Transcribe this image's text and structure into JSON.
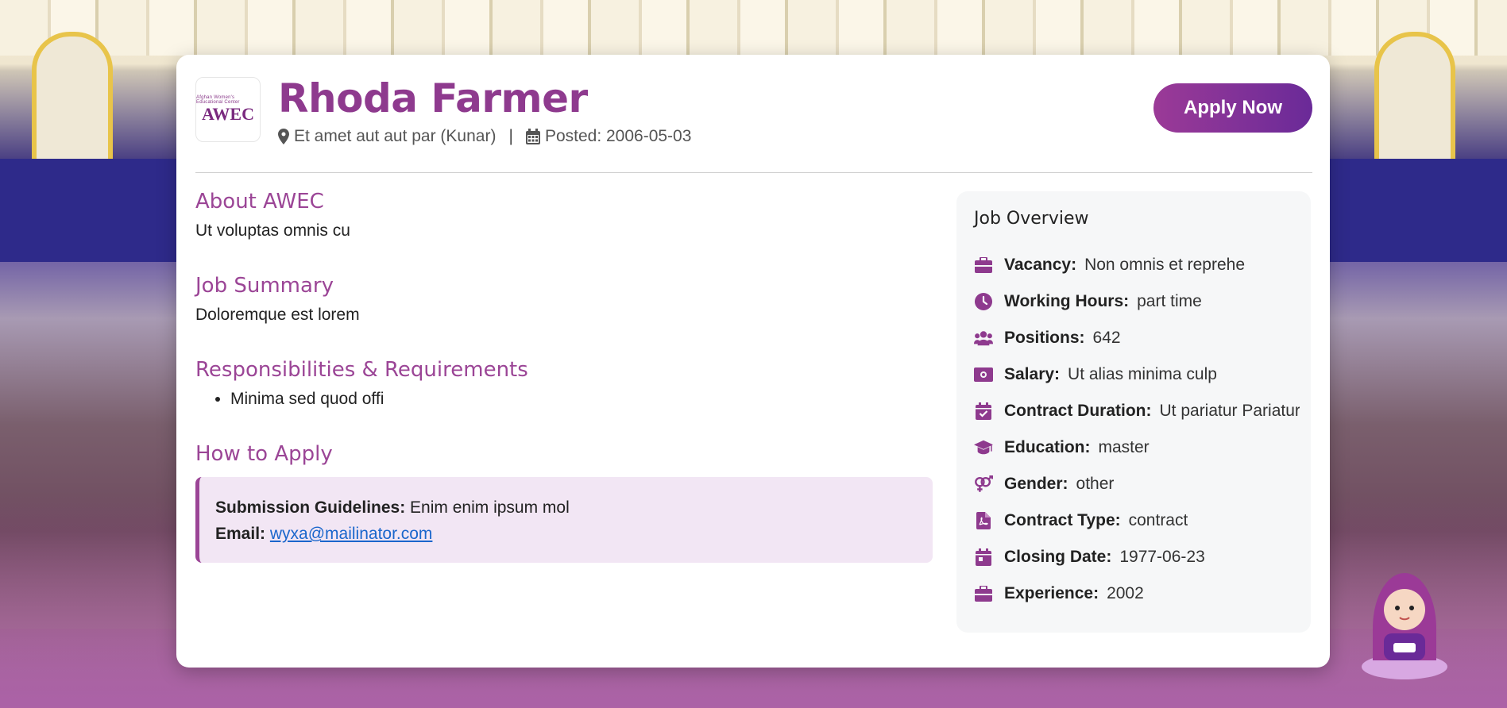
{
  "job": {
    "title": "Rhoda Farmer",
    "location": "Et amet aut aut par (Kunar)",
    "separator": "|",
    "posted": "Posted: 2006-05-03",
    "apply_label": "Apply Now"
  },
  "logo": {
    "brand": "AWEC",
    "tagline": "Afghan Women's Educational Center"
  },
  "sections": {
    "about_title": "About AWEC",
    "about_text": "Ut voluptas omnis cu",
    "summary_title": "Job Summary",
    "summary_text": "Doloremque est lorem",
    "resp_title": "Responsibilities & Requirements",
    "resp_items": [
      "Minima sed quod offi"
    ],
    "how_title": "How to Apply",
    "guidelines_label": "Submission Guidelines:",
    "guidelines_text": "Enim enim ipsum mol",
    "email_label": "Email:",
    "email": "wyxa@mailinator.com"
  },
  "overview": {
    "title": "Job Overview",
    "items": [
      {
        "icon": "briefcase-icon",
        "label": "Vacancy:",
        "value": "Non omnis et reprehe"
      },
      {
        "icon": "clock-icon",
        "label": "Working Hours:",
        "value": "part time"
      },
      {
        "icon": "users-icon",
        "label": "Positions:",
        "value": "642"
      },
      {
        "icon": "money-icon",
        "label": "Salary:",
        "value": "Ut alias minima culp"
      },
      {
        "icon": "calendar-check-icon",
        "label": "Contract Duration:",
        "value": "Ut pariatur Pariatur"
      },
      {
        "icon": "graduation-cap-icon",
        "label": "Education:",
        "value": "master"
      },
      {
        "icon": "gender-icon",
        "label": "Gender:",
        "value": "other"
      },
      {
        "icon": "contract-file-icon",
        "label": "Contract Type:",
        "value": "contract"
      },
      {
        "icon": "calendar-icon",
        "label": "Closing Date:",
        "value": "1977-06-23"
      },
      {
        "icon": "briefcase-icon",
        "label": "Experience:",
        "value": "2002"
      }
    ]
  },
  "colors": {
    "accent": "#9b4596",
    "title": "#8e3a8e",
    "button_start": "#9b3a97",
    "button_end": "#6a2a98",
    "apply_box_bg": "#f2e6f4",
    "overview_bg": "#f6f7f8"
  }
}
